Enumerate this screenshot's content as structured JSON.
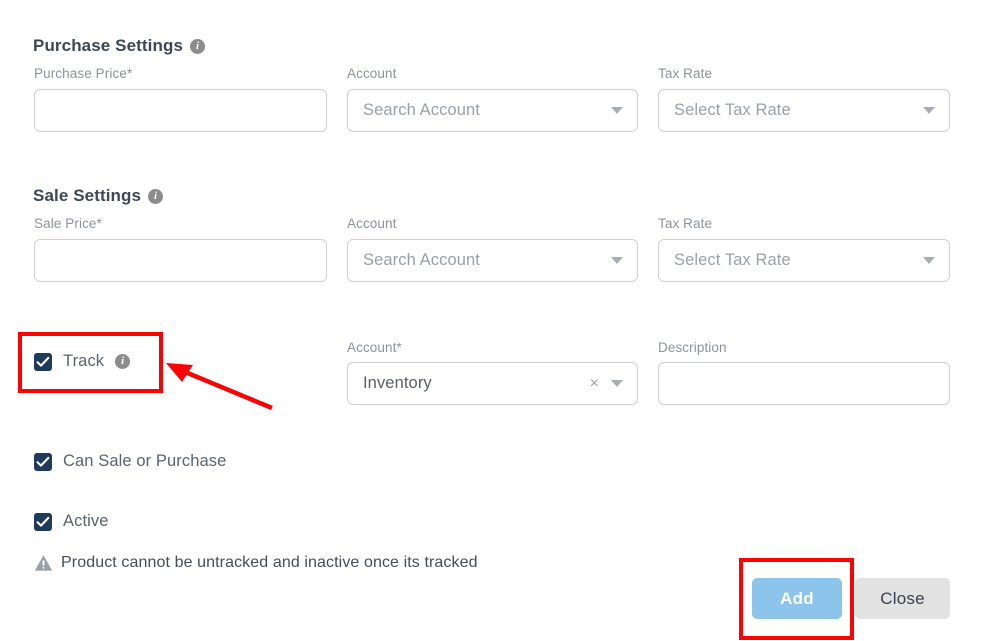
{
  "sections": [
    {
      "title": "Purchase Settings",
      "info_icon": "info-icon",
      "fields": [
        {
          "label": "Purchase Price",
          "required": "*",
          "type": "text",
          "value": "",
          "placeholder": ""
        },
        {
          "label": "Account",
          "required": "",
          "type": "select",
          "value": "Search Account",
          "placeholder": "Search Account"
        },
        {
          "label": "Tax Rate",
          "required": "",
          "type": "select",
          "value": "Select Tax Rate",
          "placeholder": "Select Tax Rate"
        }
      ]
    },
    {
      "title": "Sale Settings",
      "info_icon": "info-icon",
      "fields": [
        {
          "label": "Sale Price",
          "required": "*",
          "type": "text",
          "value": "",
          "placeholder": ""
        },
        {
          "label": "Account",
          "required": "",
          "type": "select",
          "value": "Search Account",
          "placeholder": "Search Account"
        },
        {
          "label": "Tax Rate",
          "required": "",
          "type": "select",
          "value": "Select Tax Rate",
          "placeholder": "Select Tax Rate"
        }
      ]
    }
  ],
  "track_row": {
    "checkbox_label": "Track",
    "checked": true,
    "info_icon": "info-icon",
    "account": {
      "label": "Account",
      "required": "*",
      "value": "Inventory",
      "clear_glyph": "×",
      "caret": "chevron-down-icon"
    },
    "description": {
      "label": "Description",
      "value": "",
      "placeholder": ""
    }
  },
  "toggles": [
    {
      "label": "Can Sale or Purchase",
      "checked": true
    },
    {
      "label": "Active",
      "checked": true
    }
  ],
  "warning": {
    "icon": "warning-triangle-icon",
    "text": "Product cannot be untracked and inactive once its tracked"
  },
  "buttons": {
    "add_label": "Add",
    "close_label": "Close"
  },
  "colors": {
    "accent_add_button": "#8cc4ec",
    "close_button": "#e2e2e2",
    "checkbox": "#1e3a5f",
    "annotation_red": "#fb0303",
    "label_gray": "#8d939c",
    "heading": "#3d4756"
  },
  "annotations": {
    "track_highlight": "red-rectangle-highlight",
    "track_arrow": "red-arrow-pointer",
    "add_highlight": "red-rectangle-highlight"
  }
}
